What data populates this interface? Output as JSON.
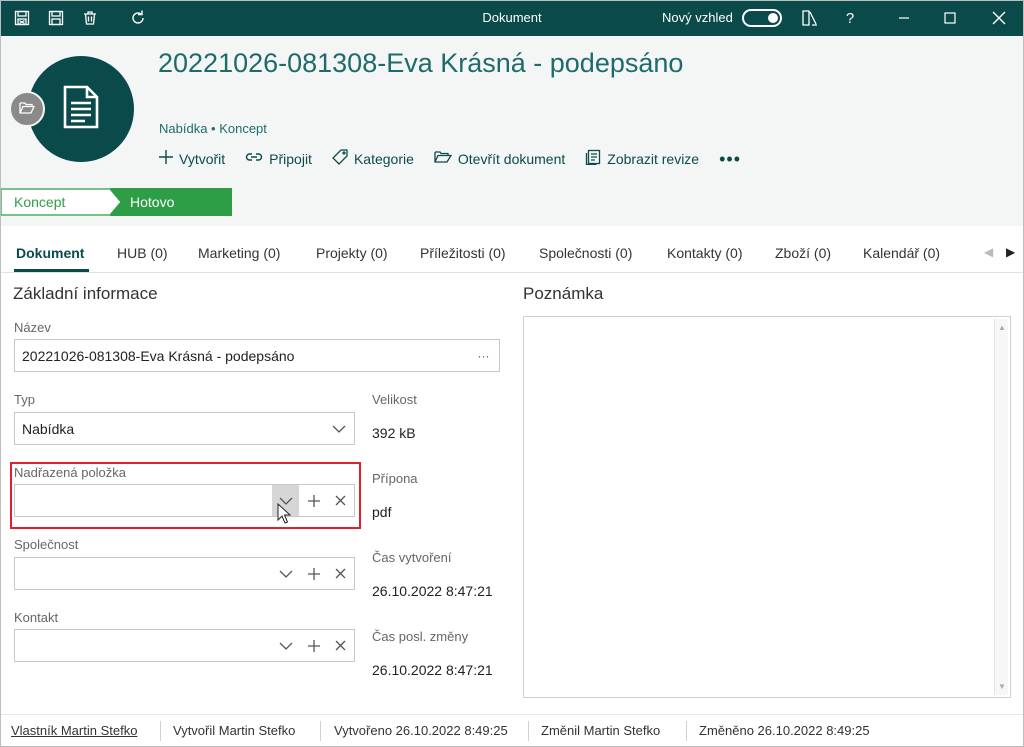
{
  "window": {
    "title": "Dokument",
    "new_look_label": "Nový vzhled",
    "new_look_enabled": true,
    "help_label": "?"
  },
  "header": {
    "title": "20221026-081308-Eva Krásná - podepsáno",
    "subtitle": "Nabídka • Koncept",
    "actions": [
      {
        "label": "Vytvořit",
        "icon": "plus-icon"
      },
      {
        "label": "Připojit",
        "icon": "link-icon"
      },
      {
        "label": "Kategorie",
        "icon": "tag-icon"
      },
      {
        "label": "Otevřít dokument",
        "icon": "folder-open-icon"
      },
      {
        "label": "Zobrazit revize",
        "icon": "revisions-icon"
      }
    ],
    "more_label": "•••"
  },
  "stages": [
    {
      "label": "Koncept",
      "active": false
    },
    {
      "label": "Hotovo",
      "active": true
    }
  ],
  "tabs": [
    {
      "label": "Dokument",
      "active": true
    },
    {
      "label": "HUB (0)"
    },
    {
      "label": "Marketing (0)"
    },
    {
      "label": "Projekty (0)"
    },
    {
      "label": "Příležitosti (0)"
    },
    {
      "label": "Společnosti (0)"
    },
    {
      "label": "Kontakty (0)"
    },
    {
      "label": "Zboží (0)"
    },
    {
      "label": "Kalendář (0)"
    }
  ],
  "basic": {
    "section_title": "Základní informace",
    "name_label": "Název",
    "name_value": "20221026-081308-Eva Krásná - podepsáno",
    "type_label": "Typ",
    "type_value": "Nabídka",
    "parent_label": "Nadřazená položka",
    "parent_value": "",
    "company_label": "Společnost",
    "company_value": "",
    "contact_label": "Kontakt",
    "contact_value": ""
  },
  "info": {
    "size_label": "Velikost",
    "size_value": "392 kB",
    "ext_label": "Přípona",
    "ext_value": "pdf",
    "created_label": "Čas vytvoření",
    "created_value": "26.10.2022 8:47:21",
    "modified_label": "Čas posl. změny",
    "modified_value": "26.10.2022 8:47:21"
  },
  "notes": {
    "section_title": "Poznámka",
    "value": ""
  },
  "footer": {
    "owner": "Vlastník Martin Stefko",
    "created_by": "Vytvořil Martin Stefko",
    "created_at": "Vytvořeno 26.10.2022 8:49:25",
    "modified_by": "Změnil Martin Stefko",
    "modified_at": "Změněno 26.10.2022 8:49:25"
  },
  "colors": {
    "brand": "#0b4a4a",
    "accent_text": "#1f6b6b",
    "stage_active": "#2e9e46",
    "highlight": "#e0202a"
  }
}
